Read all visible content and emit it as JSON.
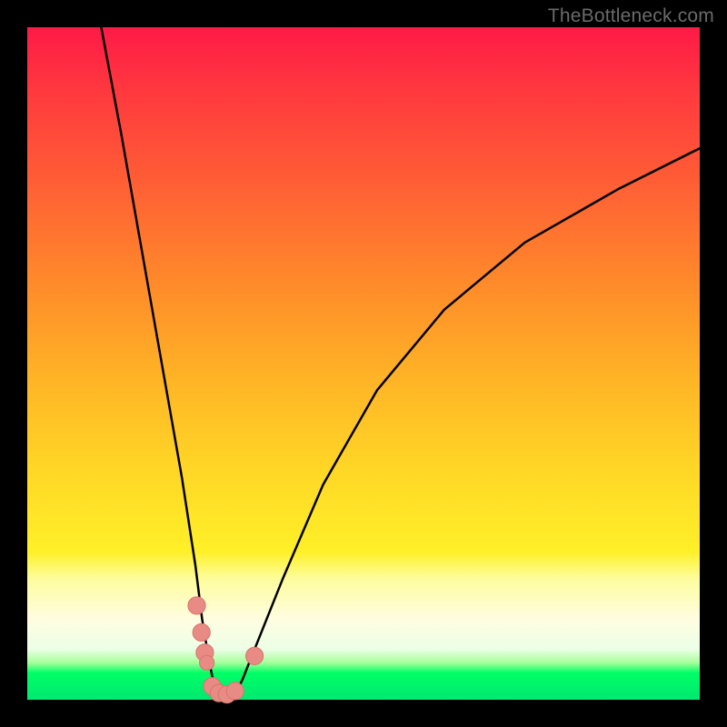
{
  "watermark": "TheBottleneck.com",
  "colors": {
    "frame": "#000000",
    "curve_stroke": "#000000",
    "marker_fill": "#e88b84",
    "marker_stroke": "#d9746d",
    "gradient_stops": [
      "#ff1a47",
      "#ff3a3e",
      "#ff5b36",
      "#ff8a2a",
      "#ffb326",
      "#ffd726",
      "#fff028",
      "#fdfd9d",
      "#fffde0",
      "#ecffe6",
      "#a6ff9a",
      "#00ff66",
      "#00e870"
    ]
  },
  "chart_data": {
    "type": "line",
    "title": "",
    "xlabel": "",
    "ylabel": "",
    "xlim": [
      0,
      100
    ],
    "ylim": [
      0,
      100
    ],
    "note": "Axes unlabeled; values estimated from pixel positions on a 0–100 normalized scale. Curve is V-shaped with vertex ~x=28, y≈0; left branch steep to top-left corner, right branch rises slowly to upper-right.",
    "series": [
      {
        "name": "bottleneck-curve",
        "x": [
          11,
          14,
          17,
          20,
          23,
          25,
          26,
          27,
          28,
          29,
          30,
          31,
          32,
          34,
          38,
          44,
          52,
          62,
          74,
          88,
          100
        ],
        "y": [
          100,
          84,
          67,
          50,
          33,
          20,
          12,
          6,
          1,
          0.5,
          0.5,
          1,
          3,
          8,
          18,
          32,
          46,
          58,
          68,
          76,
          82
        ]
      }
    ],
    "markers": [
      {
        "name": "left-cluster-1",
        "x": 25.2,
        "y": 14.0,
        "r": 1.3
      },
      {
        "name": "left-cluster-2",
        "x": 25.9,
        "y": 10.0,
        "r": 1.3
      },
      {
        "name": "left-cluster-3",
        "x": 26.4,
        "y": 7.0,
        "r": 1.3
      },
      {
        "name": "left-cluster-4",
        "x": 26.7,
        "y": 5.5,
        "r": 1.1
      },
      {
        "name": "vertex-1",
        "x": 27.5,
        "y": 2.0,
        "r": 1.3
      },
      {
        "name": "vertex-2",
        "x": 28.5,
        "y": 1.0,
        "r": 1.3
      },
      {
        "name": "vertex-3",
        "x": 29.7,
        "y": 0.8,
        "r": 1.3
      },
      {
        "name": "vertex-4",
        "x": 30.9,
        "y": 1.3,
        "r": 1.3
      },
      {
        "name": "right-dot",
        "x": 33.8,
        "y": 6.5,
        "r": 1.3
      }
    ]
  }
}
